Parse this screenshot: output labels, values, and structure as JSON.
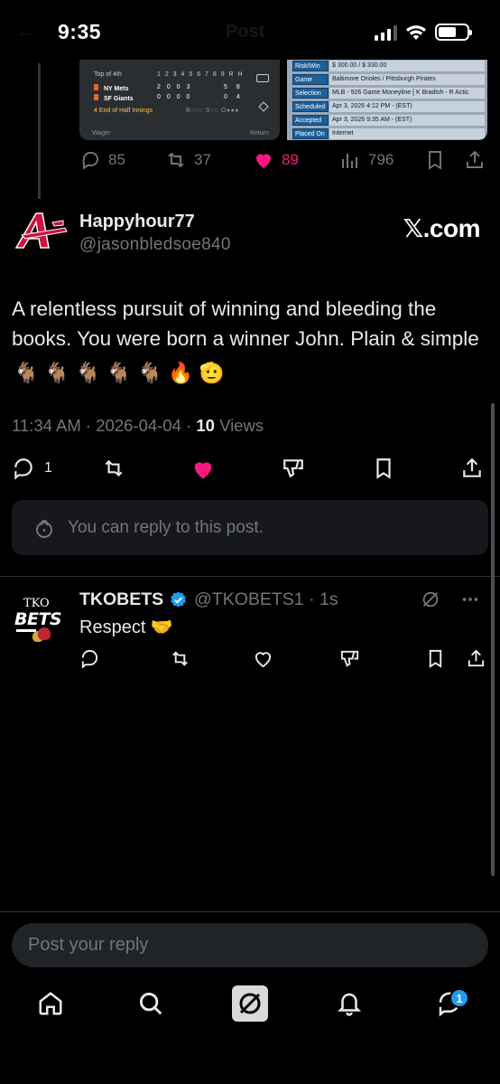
{
  "status_bar": {
    "time": "9:35",
    "ghost_title": "Post"
  },
  "colors": {
    "background": "#000000",
    "like_pink": "#f91880",
    "accent_blue": "#1d9bf0",
    "muted": "#71767b"
  },
  "quoted_media": {
    "scoreboard": {
      "inning_label": "Top of 4th",
      "innings_header": "1 2 3 4 5 6 7 8 9 R H",
      "team1": "NY Mets",
      "team2": "SF Giants",
      "team1_line": "2 0 0 3",
      "team2_line": "0 0 0 0",
      "team1_rh": "5 8",
      "team2_rh": "0 4",
      "status": "4  End of Half Innings",
      "bso": "B○○○ S○○ O●●●",
      "wager_label": "Wager",
      "return_label": "Return"
    },
    "bet_slip": [
      {
        "label": "Risk/Win",
        "value": "$ 300.00 / $ 330.00"
      },
      {
        "label": "Game",
        "value": "Baltimore Orioles / Pittsburgh Pirates"
      },
      {
        "label": "Selection",
        "value": "MLB - 926 Game Moneyline  [ K Bradish - R Actic"
      },
      {
        "label": "Scheduled",
        "value": "Apr 3, 2026 4:12 PM - (EST)"
      },
      {
        "label": "Accepted",
        "value": "Apr 3, 2026 9:35 AM - (EST)"
      },
      {
        "label": "Placed On",
        "value": "Internet"
      }
    ]
  },
  "quoted_engagement": {
    "replies": "85",
    "reposts": "37",
    "likes": "89",
    "views": "796"
  },
  "main_post": {
    "display_name": "Happyhour77",
    "handle": "@jasonbledsoe840",
    "site_mark": "𝕏.com",
    "text": "A relentless pursuit of winning and bleeding the books. You were born a winner John. Plain & simple",
    "emojis": "🐐 🐐 🐐 🐐 🐐 🔥 🫡",
    "time": "11:34 AM",
    "date": "2026-04-04",
    "views_count": "10",
    "views_label": "Views",
    "reply_count": "1",
    "reply_restriction": "You can reply to this post."
  },
  "reply": {
    "avatar_top_text": "TKO",
    "avatar_brand": "BETS",
    "display_name": "TKOBETS",
    "handle_time": "@TKOBETS1 · 1s",
    "text": "Respect 🤝"
  },
  "composer": {
    "placeholder": "Post your reply"
  },
  "tabbar": {
    "messages_badge": "1"
  }
}
